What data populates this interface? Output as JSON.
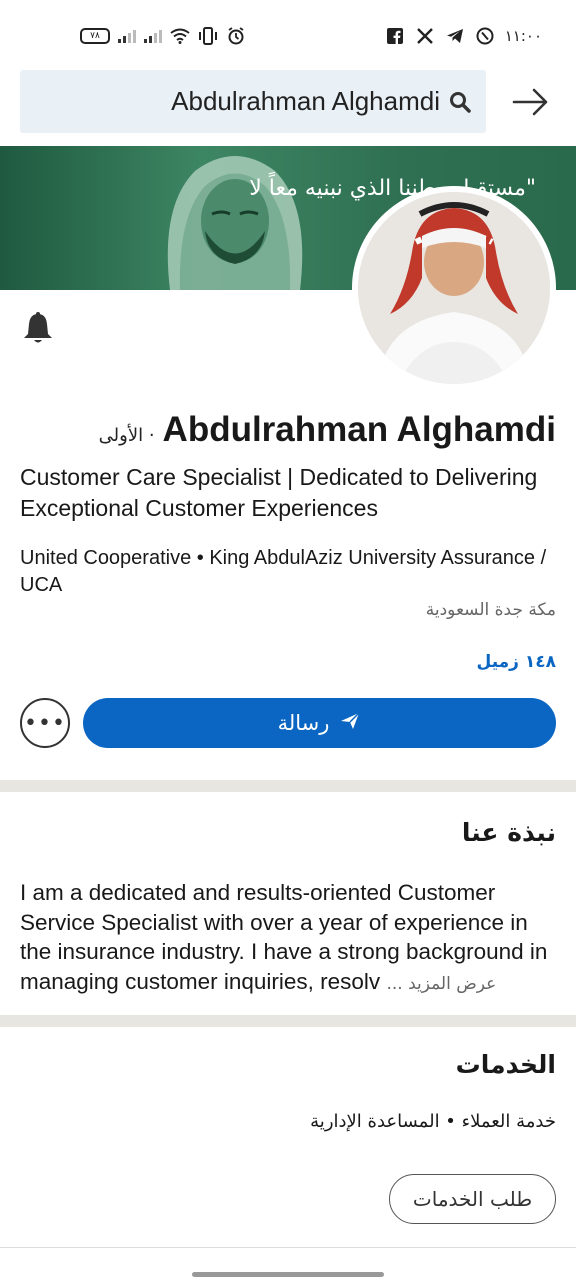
{
  "status_bar": {
    "battery": "٧٨",
    "time": "١١:٠٠",
    "icons": [
      "signal-icon",
      "signal-icon",
      "wifi-icon",
      "vibrate-icon",
      "alarm-icon",
      "facebook-icon",
      "x-icon",
      "telegram-icon",
      "whatsapp-icon"
    ]
  },
  "search": {
    "query": "Abdulrahman Alghamdi"
  },
  "banner": {
    "text": "\"مستقبل وطننا الذي نبنيه معاً لا"
  },
  "profile": {
    "name": "Abdulrahman Alghamdi",
    "degree": "· الأولى",
    "headline": "Customer Care Specialist | Dedicated to Delivering Exceptional Customer Experiences",
    "org": "United Cooperative • King AbdulAziz University Assurance / UCA",
    "location": "مكة جدة السعودية",
    "connections": "١٤٨ زميل"
  },
  "actions": {
    "more_label": "•••",
    "message_label": "رسالة"
  },
  "about": {
    "title": "نبذة عنا",
    "text": "I am a dedicated and results-oriented Customer Service Specialist with over a year of experience in the insurance industry. I have a strong background in managing customer inquiries, resolv",
    "see_more": "... عرض المزيد"
  },
  "services": {
    "title": "الخدمات",
    "items": "خدمة العملاء • المساعدة الإدارية",
    "request_label": "طلب الخدمات"
  },
  "colors": {
    "accent": "#0a66c2",
    "banner": "#2e6e52",
    "divider": "#e8e6e1"
  }
}
